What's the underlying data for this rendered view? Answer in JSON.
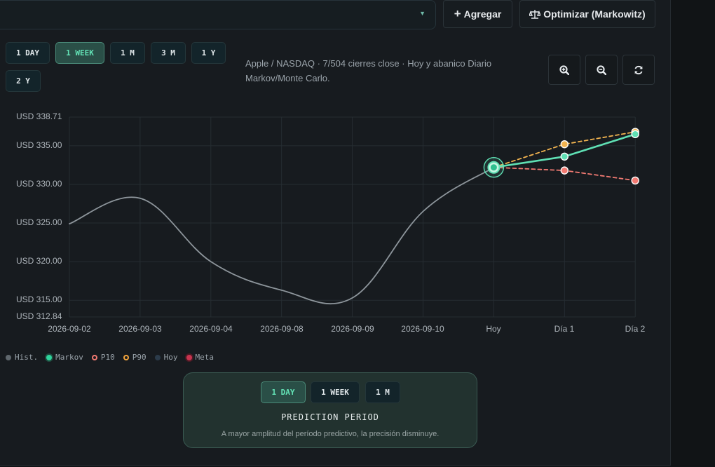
{
  "toolbar": {
    "add_label": "Agregar",
    "optimize_label": "Optimizar (Markowitz)"
  },
  "ranges": [
    {
      "label": "1 DAY",
      "active": false
    },
    {
      "label": "1 WEEK",
      "active": true
    },
    {
      "label": "1 M",
      "active": false
    },
    {
      "label": "3 M",
      "active": false
    },
    {
      "label": "1 Y",
      "active": false
    },
    {
      "label": "2 Y",
      "active": false
    }
  ],
  "subtitle": "Apple / NASDAQ · 7/504 cierres close · Hoy y abanico Diario Markov/Monte Carlo.",
  "icons": {
    "zoom_in": "zoom-in-icon",
    "zoom_out": "zoom-out-icon",
    "refresh": "refresh-icon",
    "add": "plus-icon",
    "optimize": "scale-icon"
  },
  "colors": {
    "history": "#8d959b",
    "markov": "#5fe0b4",
    "p10": "#f27a72",
    "p90": "#f2b450",
    "hoy": "#2b3b4a",
    "meta": "#e0405a",
    "accent": "#63e3b6"
  },
  "legend": [
    {
      "label": "Hist.",
      "key": "history"
    },
    {
      "label": "Markov",
      "key": "markov"
    },
    {
      "label": "P10",
      "key": "p10"
    },
    {
      "label": "P90",
      "key": "p90"
    },
    {
      "label": "Hoy",
      "key": "hoy"
    },
    {
      "label": "Meta",
      "key": "meta"
    }
  ],
  "prediction": {
    "options": [
      {
        "label": "1 DAY",
        "active": true
      },
      {
        "label": "1 WEEK",
        "active": false
      },
      {
        "label": "1 M",
        "active": false
      }
    ],
    "title": "PREDICTION PERIOD",
    "note": "A mayor amplitud del período predictivo, la precisión disminuye."
  },
  "chart_data": {
    "type": "line",
    "categories": [
      "2026-09-02",
      "2026-09-03",
      "2026-09-04",
      "2026-09-08",
      "2026-09-09",
      "2026-09-10",
      "Hoy",
      "Día 1",
      "Día 2"
    ],
    "ylim": [
      312.84,
      338.71
    ],
    "y_ticks": [
      "USD 338.71",
      "USD 335.00",
      "USD 330.00",
      "USD 325.00",
      "USD 320.00",
      "USD 315.00",
      "USD 312.84"
    ],
    "y_tick_values": [
      338.71,
      335.0,
      330.0,
      325.0,
      320.0,
      315.0,
      312.84
    ],
    "grid": true,
    "series": [
      {
        "name": "Hist.",
        "key": "history",
        "x_index": [
          0,
          1,
          2,
          3,
          4,
          5,
          6
        ],
        "values": [
          324.9,
          328.2,
          320.0,
          316.3,
          315.3,
          326.5,
          332.2
        ]
      },
      {
        "name": "Markov",
        "key": "markov",
        "x_index": [
          6,
          7,
          8
        ],
        "values": [
          332.2,
          333.6,
          336.5
        ]
      },
      {
        "name": "P10",
        "key": "p10",
        "x_index": [
          6,
          7,
          8
        ],
        "values": [
          332.2,
          331.8,
          330.5
        ]
      },
      {
        "name": "P90",
        "key": "p90",
        "x_index": [
          6,
          7,
          8
        ],
        "values": [
          332.2,
          335.2,
          336.8
        ]
      }
    ]
  }
}
